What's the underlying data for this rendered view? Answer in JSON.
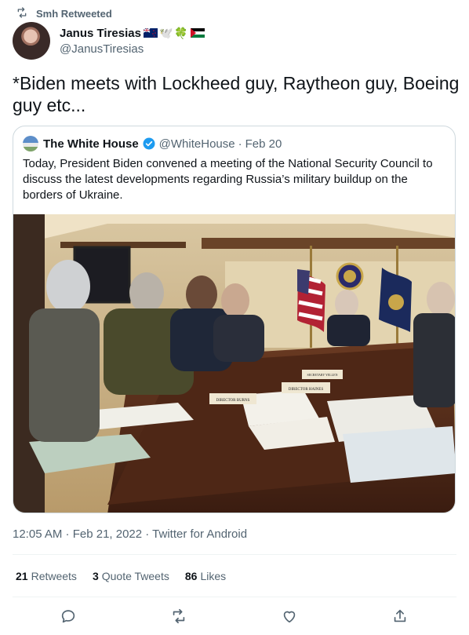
{
  "retweet_header": {
    "text": "Smh Retweeted",
    "icon": "retweet-icon"
  },
  "author": {
    "name": "Janus Tiresias",
    "handle": "@JanusTiresias",
    "name_emojis": [
      "🕊️",
      "🍀"
    ]
  },
  "tweet": {
    "text": "*Biden meets with Lockheed guy, Raytheon guy, Boeing guy etc..."
  },
  "quoted": {
    "name": "The White House",
    "handle": "@WhiteHouse",
    "separator": "·",
    "date": "Feb 20",
    "text": "Today, President Biden convened a meeting of the National Security Council to discuss the latest developments regarding Russia’s military buildup on the borders of Ukraine.",
    "photo_nameplates": [
      "DIRECTOR BURNS",
      "DIRECTOR HAINES",
      "SECRETARY YELLEN"
    ]
  },
  "meta": {
    "text": "12:05 AM · Feb 21, 2022 · Twitter for Android"
  },
  "stats": {
    "retweets_count": "21",
    "retweets_label": "Retweets",
    "quotes_count": "3",
    "quotes_label": "Quote Tweets",
    "likes_count": "86",
    "likes_label": "Likes"
  },
  "actions": [
    "reply-icon",
    "retweet-icon",
    "like-icon",
    "share-icon"
  ],
  "colors": {
    "secondary_text": "#536471",
    "border": "#cfd9de",
    "verified": "#1d9bf0"
  }
}
